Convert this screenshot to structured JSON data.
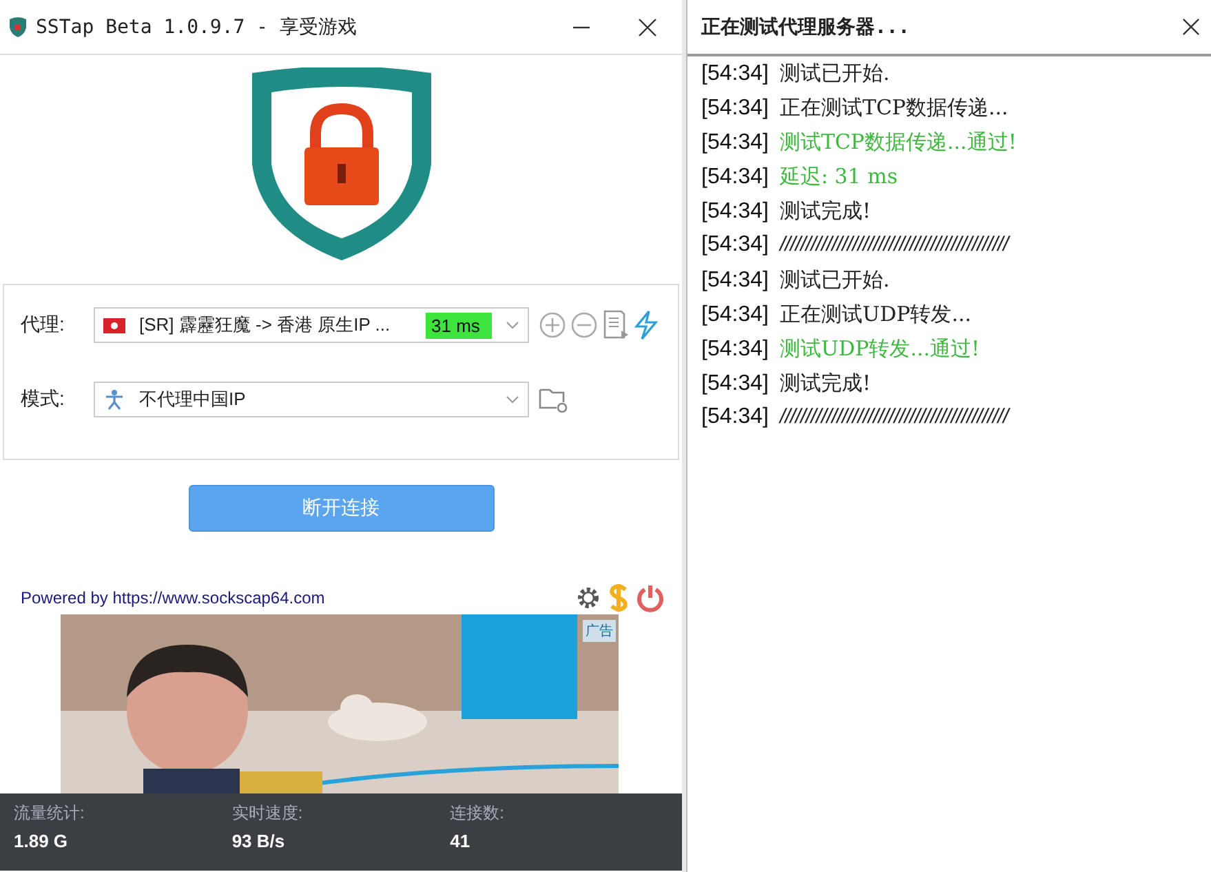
{
  "window": {
    "title": "SSTap Beta 1.0.9.7 - 享受游戏"
  },
  "proxy": {
    "label": "代理:",
    "value": "[SR] 霹靂狂魔 -> 香港  原生IP ...",
    "latency": "31 ms"
  },
  "mode": {
    "label": "模式:",
    "value": "不代理中国IP"
  },
  "connect_button": "断开连接",
  "powered_by": "Powered by https://www.sockscap64.com",
  "ad": {
    "badge": "广告"
  },
  "stats": [
    {
      "label": "流量统计:",
      "value": "1.89 G"
    },
    {
      "label": "实时速度:",
      "value": "93 B/s"
    },
    {
      "label": "连接数:",
      "value": "41"
    }
  ],
  "log_panel": {
    "title": "正在测试代理服务器...",
    "lines": [
      {
        "time": "[54:34]",
        "text": "测试已开始.",
        "kind": "info"
      },
      {
        "time": "[54:34]",
        "text": "正在测试TCP数据传递...",
        "kind": "info"
      },
      {
        "time": "[54:34]",
        "text": "测试TCP数据传递...通过!",
        "kind": "pass"
      },
      {
        "time": "[54:34]",
        "text": "延迟: 31 ms",
        "kind": "pass"
      },
      {
        "time": "[54:34]",
        "text": "测试完成!",
        "kind": "info"
      },
      {
        "time": "[54:34]",
        "text": "////////////////////////////////////////////",
        "kind": "rule"
      },
      {
        "time": "[54:34]",
        "text": "测试已开始.",
        "kind": "info"
      },
      {
        "time": "[54:34]",
        "text": "正在测试UDP转发...",
        "kind": "info"
      },
      {
        "time": "[54:34]",
        "text": "测试UDP转发...通过!",
        "kind": "pass"
      },
      {
        "time": "[54:34]",
        "text": "测试完成!",
        "kind": "info"
      },
      {
        "time": "[54:34]",
        "text": "////////////////////////////////////////////",
        "kind": "rule"
      }
    ]
  }
}
